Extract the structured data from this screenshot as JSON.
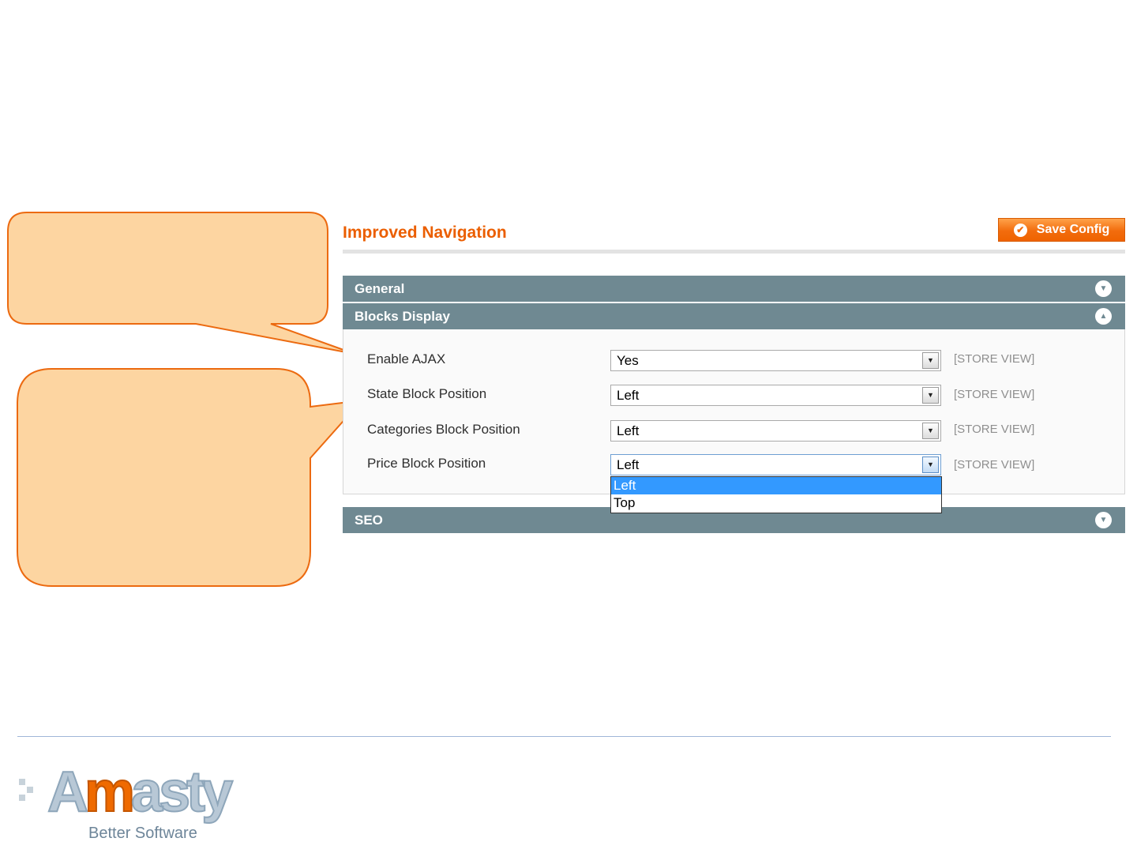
{
  "page": {
    "title": "Improved Navigation",
    "save_label": "Save Config"
  },
  "sections": {
    "general": {
      "label": "General"
    },
    "blocks": {
      "label": "Blocks Display"
    },
    "seo": {
      "label": "SEO"
    }
  },
  "fields": [
    {
      "label": "Enable AJAX",
      "value": "Yes",
      "scope": "[STORE VIEW]"
    },
    {
      "label": "State Block Position",
      "value": "Left",
      "scope": "[STORE VIEW]"
    },
    {
      "label": "Categories Block Position",
      "value": "Left",
      "scope": "[STORE VIEW]"
    },
    {
      "label": "Price Block Position",
      "value": "Left",
      "scope": "[STORE VIEW]"
    }
  ],
  "price_dropdown": {
    "options": [
      "Left",
      "Top"
    ],
    "highlighted": "Left"
  },
  "footer": {
    "logo_text": "Amasty",
    "tagline": "Better Software"
  },
  "colors": {
    "accent": "#eb5e00",
    "section_header": "#6f8992",
    "callout_fill": "#fdd5a1",
    "callout_stroke": "#ec6a10",
    "selection": "#3399ff"
  },
  "icons": {
    "save": "check-circle-icon",
    "section_collapsed": "chevron-down-circle-icon",
    "section_expanded": "chevron-up-circle-icon",
    "select_arrow": "caret-down-icon"
  }
}
